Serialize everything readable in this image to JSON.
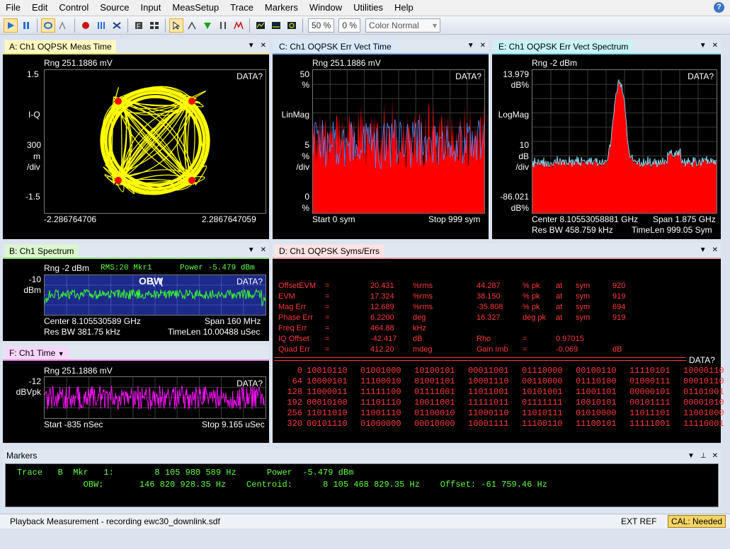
{
  "menu": [
    "File",
    "Edit",
    "Control",
    "Source",
    "Input",
    "MeasSetup",
    "Trace",
    "Markers",
    "Window",
    "Utilities",
    "Help"
  ],
  "help_icon": "?",
  "toolbar": {
    "zoom_pct": "50 %",
    "pct2": "0 %",
    "color_scheme": "Color Normal"
  },
  "panes": {
    "a": {
      "title": "A: Ch1 OQPSK Meas Time",
      "range": "Rng 251.1886 mV",
      "data": "DATA?",
      "ytop": "1.5",
      "yname": "I-Q",
      "yscale1": "300",
      "yscale2": "m",
      "yscale3": "/div",
      "ybot": "-1.5",
      "xleft": "-2.286764706",
      "xright": "2.2867647059"
    },
    "c": {
      "title": "C: Ch1 OQPSK Err Vect Time",
      "range": "Rng 251.1886 mV",
      "data": "DATA?",
      "ytop": "50",
      "ytop_u": "%",
      "yname": "LinMag",
      "ymid": "5",
      "ymid_u": "%",
      "ydiv": "/div",
      "ybot": "0",
      "ybot_u": "%",
      "start": "Start 0  sym",
      "stop": "Stop 999  sym"
    },
    "e": {
      "title": "E: Ch1 OQPSK Err Vect Spectrum",
      "range": "Rng -2 dBm",
      "data": "DATA?",
      "ytop": "13.979",
      "ytop_u": "dB%",
      "yname": "LogMag",
      "ymid": "10",
      "ymid_u": "dB",
      "ydiv": "/div",
      "ybot": "-86.021",
      "ybot_u": "dB%",
      "center": "Center 8.10553058881 GHz",
      "span": "Span 1.875 GHz",
      "resbw": "Res BW 458.759 kHz",
      "timelen": "TimeLen 999.05  Sym"
    },
    "b": {
      "title": "B: Ch1 Spectrum",
      "range": "Rng -2 dBm",
      "rms": "RMS:20 Mkr1",
      "power": "Power   -5.479 dBm",
      "data": "DATA?",
      "ytop": "-10",
      "ytop_u": "dBm",
      "obw": "OBW",
      "center": "Center 8.105530589 GHz",
      "span": "Span 160 MHz",
      "resbw": "Res BW 381.75 kHz",
      "timelen": "TimeLen 10.00488 uSec"
    },
    "d": {
      "title": "D: Ch1 OQPSK Syms/Errs",
      "data": "DATA?",
      "metrics": [
        [
          "OffsetEVM",
          "=",
          "20.431",
          "%rms",
          "44.287",
          "% pk",
          "at",
          "sym",
          "920"
        ],
        [
          "EVM",
          "=",
          "17.324",
          "%rms",
          "38.150",
          "% pk",
          "at",
          "sym",
          "919"
        ],
        [
          "Mag Err",
          "=",
          "12.689",
          "%rms",
          "-35.808",
          "% pk",
          "at",
          "sym",
          "694"
        ],
        [
          "Phase Err",
          "=",
          "6.2200",
          "deg",
          "16.327",
          "deg pk",
          "at",
          "sym",
          "919"
        ],
        [
          "Freq Err",
          "=",
          "464.88",
          "kHz",
          "",
          "",
          "",
          "",
          ""
        ],
        [
          "IQ Offset",
          "=",
          "-42.417",
          "dB",
          "Rho",
          "=",
          "0.97015",
          "",
          ""
        ],
        [
          "Quad Err",
          "=",
          "412.20",
          "mdeg",
          "Gain  Imb",
          "=",
          "-0.069",
          "",
          "dB"
        ]
      ],
      "rows": [
        [
          "0",
          "10010110",
          "01001000",
          "10100101",
          "00011001",
          "01110000",
          "00100110",
          "11110101",
          "10000110"
        ],
        [
          "64",
          "10000101",
          "11100010",
          "01001101",
          "10001110",
          "00110000",
          "01110100",
          "01000111",
          "00010110"
        ],
        [
          "128",
          "11000011",
          "11111100",
          "01111001",
          "11011001",
          "10101001",
          "11001101",
          "00000101",
          "01101001"
        ],
        [
          "192",
          "00010100",
          "11101110",
          "10011001",
          "11111011",
          "01111111",
          "10010101",
          "00101111",
          "00001010"
        ],
        [
          "256",
          "11011010",
          "11001110",
          "01100010",
          "11000110",
          "11010111",
          "01010000",
          "11011101",
          "11001000"
        ],
        [
          "320",
          "00101110",
          "01000000",
          "00010000",
          "10001111",
          "11100110",
          "11100101",
          "11111001",
          "11110001"
        ]
      ]
    },
    "f": {
      "title": "F: Ch1 Time",
      "range": "Rng 251.1886 mV",
      "data": "DATA?",
      "ytop": "-12",
      "ytop_u": "dBVpk",
      "start": "Start -835 nSec",
      "stop": "Stop 9.165 uSec"
    }
  },
  "markers": {
    "title": "Markers",
    "line1": "Trace   B  Mkr   1:        8 105 980 589 Hz      Power  -5.479 dBm",
    "line2": "             OBW:       146 820 928.35 Hz    Centroid:      8 105 468 829.35 Hz    Offset: -61 759.46 Hz"
  },
  "status": {
    "left": "Playback Measurement - recording ewc30_downlink.sdf",
    "extref": "EXT REF",
    "cal": "CAL: Needed"
  },
  "colors": {
    "trace_yellow": "#ffff00",
    "trace_red": "#ff0000",
    "trace_blue": "#4f8cff",
    "trace_cyan": "#7fe6ff",
    "trace_green": "#37ff2a",
    "trace_magenta": "#ff10ff",
    "cal_bg": "#f5d565"
  }
}
